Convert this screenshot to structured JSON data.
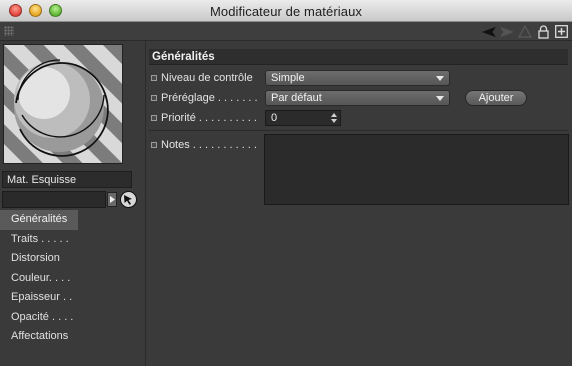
{
  "window": {
    "title": "Modificateur de matériaux"
  },
  "material": {
    "name": "Mat. Esquisse"
  },
  "nav": {
    "items": [
      {
        "label": "Généralités"
      },
      {
        "label": "Traits . . . . ."
      },
      {
        "label": "Distorsion"
      },
      {
        "label": "Couleur. . . ."
      },
      {
        "label": "Epaisseur . ."
      },
      {
        "label": "Opacité . . . ."
      },
      {
        "label": "Affectations"
      }
    ],
    "active_index": 0
  },
  "general": {
    "header": "Généralités",
    "control_level": {
      "label": "Niveau de contrôle",
      "value": "Simple"
    },
    "preset": {
      "label": "Préréglage . . . . . . .",
      "value": "Par défaut"
    },
    "add_button": "Ajouter",
    "priority": {
      "label": "Priorité . . . . . . . . . .",
      "value": "0"
    },
    "notes": {
      "label": "Notes . . . . . . . . . . .",
      "value": ""
    }
  },
  "icons": {
    "toolstrip": [
      "grip-icon",
      "arrow-left-icon",
      "arrow-right-icon",
      "triangle-icon",
      "lock-icon",
      "new-window-icon"
    ],
    "search": [
      "chevron-right-icon",
      "pick-cursor-icon"
    ]
  },
  "colors": {
    "panel_bg": "#3a3a3a",
    "field_bg": "#2b2b2b",
    "active_nav": "#5a5a5a"
  }
}
